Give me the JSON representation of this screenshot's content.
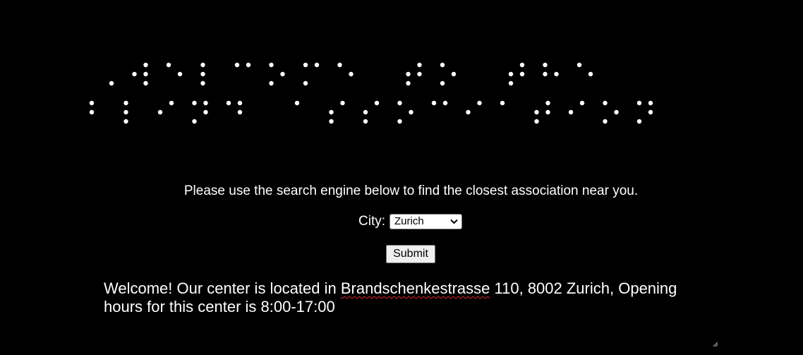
{
  "banner": {
    "braille": "⠠⠺⠑⠇⠉⠕⠍⠑ ⠞⠕ ⠞⠓⠑ ⠃⠇⠊⠝⠙ ⠁⠎⠎⠕⠉⠊⠁⠞⠊⠕⠝",
    "dot_color": "#ffffff"
  },
  "intro_text": "Please use the search engine below to find the closest association near you.",
  "form": {
    "city_label": "City:",
    "city_selected": "Zurich",
    "submit_label": "Submit"
  },
  "welcome": {
    "line_start": "Welcome! Our center is located in ",
    "street": "Brandschenkestrasse",
    "line_end": " 110, 8002 Zurich, Opening hours for this center is 8:00-17:00"
  },
  "colors": {
    "background": "#000000",
    "text": "#ffffff",
    "spellcheck": "#e0242a"
  }
}
